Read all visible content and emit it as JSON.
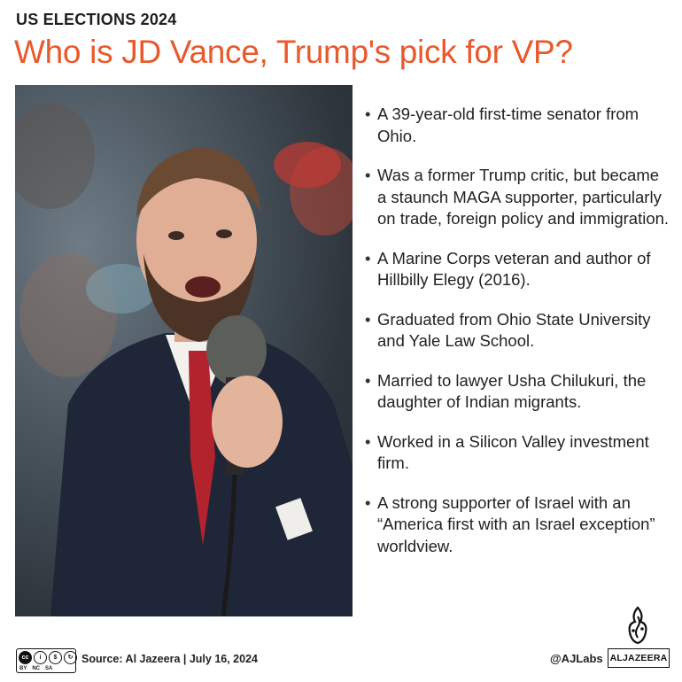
{
  "header": {
    "kicker": "US ELECTIONS 2024",
    "headline": "Who is JD Vance, Trump's pick for VP?"
  },
  "photo": {
    "subject_icon": "speaker-with-microphone-photo"
  },
  "points": [
    "A 39-year-old first-time senator  from Ohio.",
    "Was a former Trump critic, but became a staunch MAGA supporter, particularly on trade, foreign policy and immigration.",
    "A Marine Corps veteran and author of Hillbilly Elegy (2016).",
    "Graduated from Ohio State University and Yale Law School.",
    "Married to lawyer Usha Chilukuri, the daughter of Indian migrants.",
    "Worked in a Silicon Valley investment firm.",
    "A strong supporter of Israel with an “America first with an Israel exception” worldview."
  ],
  "footer": {
    "license_icon": "creative-commons-by-nc-sa-icon",
    "license_tags": [
      "BY",
      "NC",
      "SA"
    ],
    "source": "Source:  Al Jazeera  |  July 16, 2024",
    "handle": "@AJLabs",
    "logo_text": "ALJAZEERA"
  },
  "colors": {
    "headline": "#e8592b",
    "text": "#222222",
    "background": "#ffffff"
  }
}
